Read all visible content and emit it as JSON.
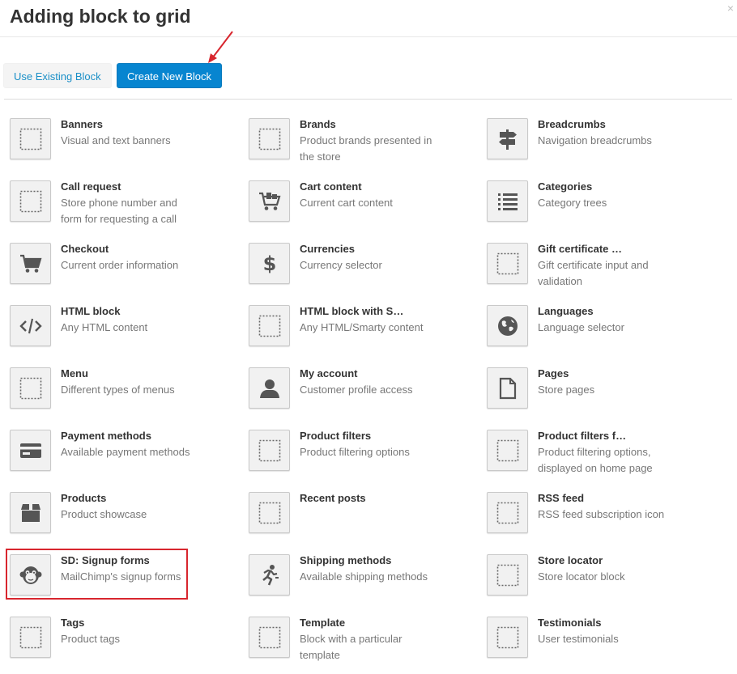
{
  "dialog": {
    "title": "Adding block to grid",
    "close_glyph": "×"
  },
  "toolbar": {
    "use_existing_label": "Use Existing Block",
    "create_new_label": "Create New Block"
  },
  "colors": {
    "accent": "#0785d0",
    "link": "#1a8fc7",
    "highlight": "#d8262e"
  },
  "blocks": [
    {
      "name": "Banners",
      "desc": "Visual and text banners",
      "icon": "placeholder-icon"
    },
    {
      "name": "Brands",
      "desc": "Product brands presented in the store",
      "icon": "placeholder-icon"
    },
    {
      "name": "Breadcrumbs",
      "desc": "Navigation breadcrumbs",
      "icon": "signpost-icon"
    },
    {
      "name": "Call request",
      "desc": "Store phone number and form for requesting a call",
      "icon": "placeholder-icon"
    },
    {
      "name": "Cart content",
      "desc": "Current cart content",
      "icon": "cart-full-icon"
    },
    {
      "name": "Categories",
      "desc": "Category trees",
      "icon": "list-icon"
    },
    {
      "name": "Checkout",
      "desc": "Current order information",
      "icon": "cart-icon"
    },
    {
      "name": "Currencies",
      "desc": "Currency selector",
      "icon": "dollar-icon"
    },
    {
      "name": "Gift certificate …",
      "desc": "Gift certificate input and validation",
      "icon": "placeholder-icon"
    },
    {
      "name": "HTML block",
      "desc": "Any HTML content",
      "icon": "code-icon"
    },
    {
      "name": "HTML block with S…",
      "desc": "Any HTML/Smarty content",
      "icon": "placeholder-icon"
    },
    {
      "name": "Languages",
      "desc": "Language selector",
      "icon": "globe-icon"
    },
    {
      "name": "Menu",
      "desc": "Different types of menus",
      "icon": "placeholder-icon"
    },
    {
      "name": "My account",
      "desc": "Customer profile access",
      "icon": "user-icon"
    },
    {
      "name": "Pages",
      "desc": "Store pages",
      "icon": "page-icon"
    },
    {
      "name": "Payment methods",
      "desc": "Available payment methods",
      "icon": "credit-card-icon"
    },
    {
      "name": "Product filters",
      "desc": "Product filtering options",
      "icon": "placeholder-icon"
    },
    {
      "name": "Product filters f…",
      "desc": "Product filtering options, displayed on home page",
      "icon": "placeholder-icon"
    },
    {
      "name": "Products",
      "desc": "Product showcase",
      "icon": "box-icon"
    },
    {
      "name": "Recent posts",
      "desc": "",
      "icon": "placeholder-icon"
    },
    {
      "name": "RSS feed",
      "desc": "RSS feed subscription icon",
      "icon": "placeholder-icon"
    },
    {
      "name": "SD: Signup forms",
      "desc": "MailChimp's signup forms",
      "icon": "monkey-icon"
    },
    {
      "name": "Shipping methods",
      "desc": "Available shipping methods",
      "icon": "runner-icon"
    },
    {
      "name": "Store locator",
      "desc": "Store locator block",
      "icon": "placeholder-icon"
    },
    {
      "name": "Tags",
      "desc": "Product tags",
      "icon": "placeholder-icon"
    },
    {
      "name": "Template",
      "desc": "Block with a particular template",
      "icon": "placeholder-icon"
    },
    {
      "name": "Testimonials",
      "desc": "User testimonials",
      "icon": "placeholder-icon"
    }
  ],
  "highlighted_block": "SD: Signup forms"
}
